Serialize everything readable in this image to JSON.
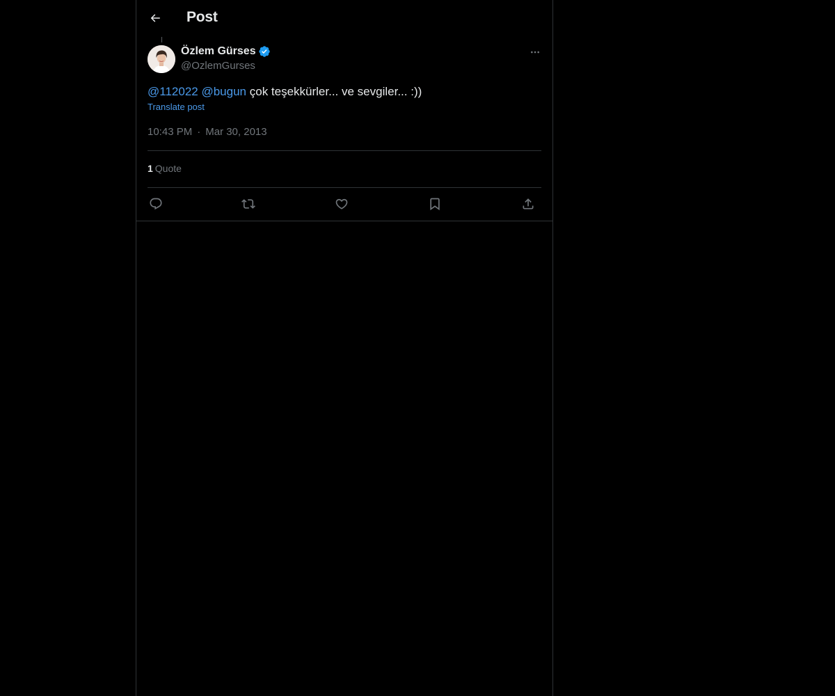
{
  "header": {
    "title": "Post"
  },
  "post": {
    "author": {
      "display_name": "Özlem Gürses",
      "handle": "@OzlemGurses",
      "verified": true
    },
    "text": {
      "mention_1": "@112022",
      "mention_2": "@bugun",
      "body": "çok teşekkürler... ve sevgiler... :))"
    },
    "translate_label": "Translate post",
    "time": "10:43 PM",
    "separator": "·",
    "date": "Mar 30, 2013",
    "stats": {
      "quote_count": "1",
      "quote_label": "Quote"
    }
  },
  "colors": {
    "background": "#000000",
    "accent": "#4a99e9",
    "text_primary": "#e7e9ea",
    "text_secondary": "#71767b",
    "border": "#2f3336",
    "verified_badge": "#1d9bf0"
  },
  "icons": {
    "back": "arrow-left-icon",
    "verified": "verified-badge-icon",
    "more": "more-horizontal-icon",
    "reply": "reply-icon",
    "repost": "repost-icon",
    "like": "heart-icon",
    "bookmark": "bookmark-icon",
    "share": "share-icon"
  }
}
